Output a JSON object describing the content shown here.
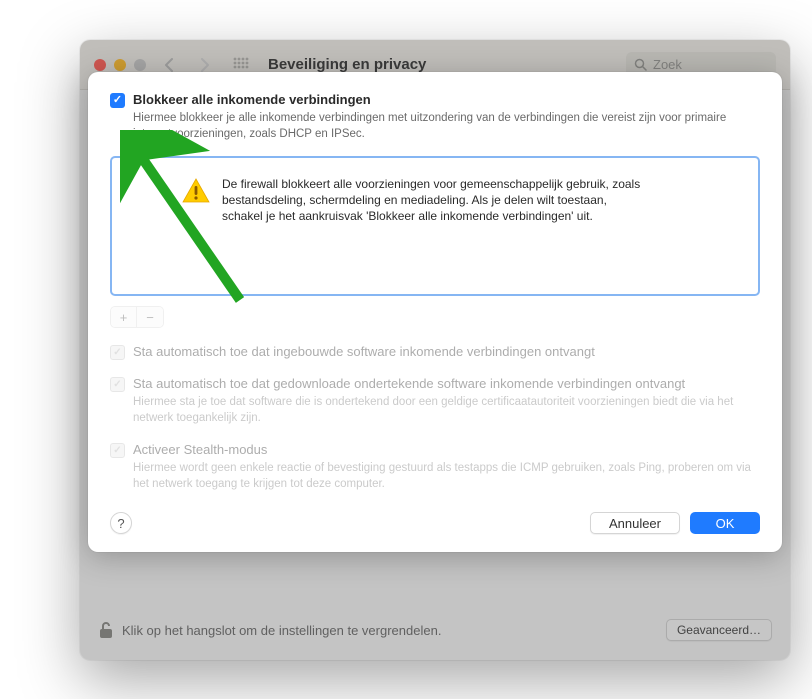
{
  "toolbar": {
    "title": "Beveiliging en privacy",
    "search_placeholder": "Zoek"
  },
  "lock": {
    "text": "Klik op het hangslot om de instellingen te vergrendelen.",
    "advanced_label": "Geavanceerd…"
  },
  "sheet": {
    "block_all_label": "Blokkeer alle inkomende verbindingen",
    "block_all_desc": "Hiermee blokkeer je alle inkomende verbindingen met uitzondering van de verbindingen die vereist zijn voor primaire internetvoorzieningen, zoals DHCP en IPSec.",
    "info_text": "De firewall blokkeert alle voorzieningen voor gemeenschappelijk gebruik, zoals bestandsdeling, schermdeling en mediadeling. Als je delen wilt toestaan, schakel je het aankruisvak 'Blokkeer alle inkomende verbindingen' uit.",
    "opt_builtin": "Sta automatisch toe dat ingebouwde software inkomende verbindingen ontvangt",
    "opt_signed": "Sta automatisch toe dat gedownloade ondertekende software inkomende verbindingen ontvangt",
    "opt_signed_desc": "Hiermee sta je toe dat software die is ondertekend door een geldige certificaatautoriteit voorzieningen biedt die via het netwerk toegankelijk zijn.",
    "opt_stealth": "Activeer Stealth-modus",
    "opt_stealth_desc": "Hiermee wordt geen enkele reactie of bevestiging gestuurd als testapps die ICMP gebruiken, zoals Ping, proberen om via het netwerk toegang te krijgen tot deze computer.",
    "cancel_label": "Annuleer",
    "ok_label": "OK",
    "help_label": "?"
  }
}
